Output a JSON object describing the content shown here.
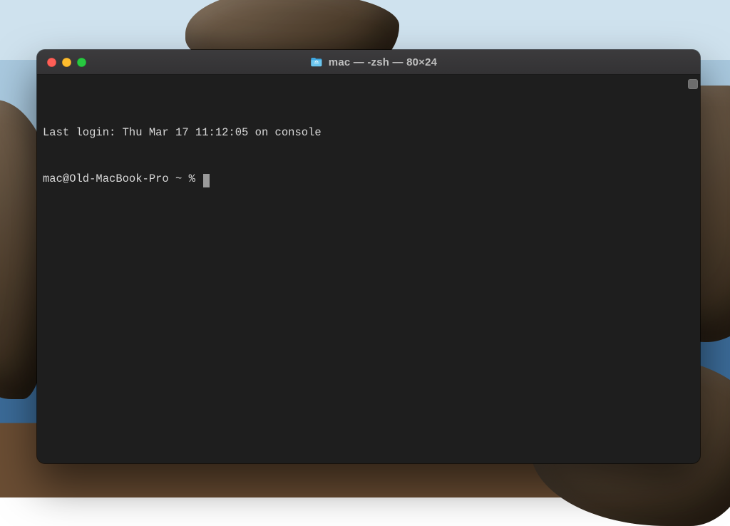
{
  "window": {
    "title": "mac — -zsh — 80×24"
  },
  "terminal": {
    "last_login_line": "Last login: Thu Mar 17 11:12:05 on console",
    "prompt": "mac@Old-MacBook-Pro ~ % "
  }
}
